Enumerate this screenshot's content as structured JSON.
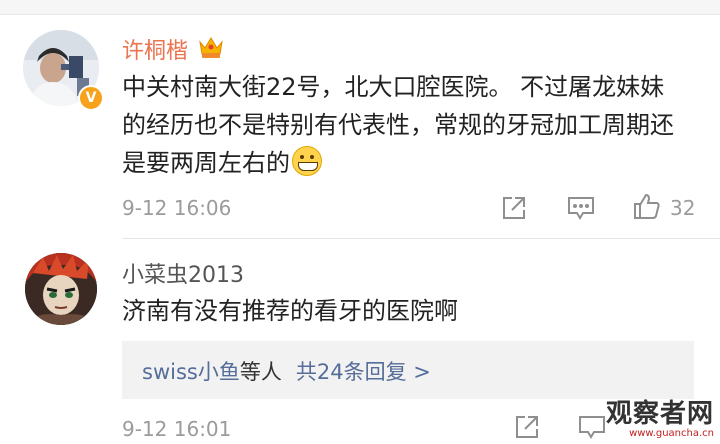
{
  "comments": [
    {
      "username": "许桐楷",
      "badge_icon": "crown-badge-icon",
      "verified_icon": "verified-v-icon",
      "verified_mark": "V",
      "text": "中关村南大街22号，北大口腔医院。 不过屠龙妹妹的经历也不是特别有代表性，常规的牙冠加工周期还是要两周左右的",
      "emoji": "grin-emoji",
      "time": "9-12 16:06",
      "like_count": "32"
    },
    {
      "username": "小菜虫2013",
      "text": "济南有没有推荐的看牙的医院啊",
      "reply_summary": {
        "user": "swiss小鱼",
        "suffix": "等人",
        "count_text": "共24条回复 >"
      },
      "time": "9-12 16:01"
    }
  ],
  "watermark": {
    "title": "观察者网",
    "url": "www.guancha.cn"
  },
  "colors": {
    "username_highlight": "#eb7350",
    "link_blue": "#556d99",
    "meta_gray": "#9b9b9b"
  }
}
